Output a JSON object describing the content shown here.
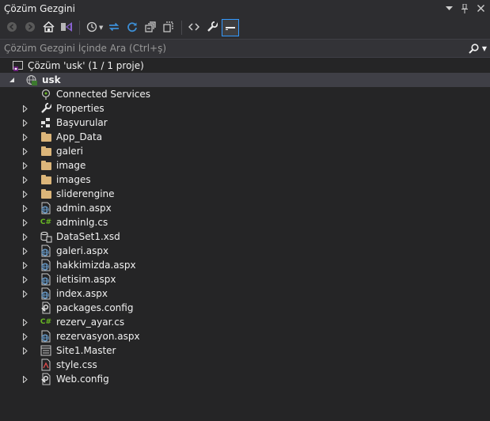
{
  "panel": {
    "title": "Çözüm Gezgini",
    "titlebar_icons": [
      "dropdown-arrow-icon",
      "pin-icon",
      "close-icon"
    ]
  },
  "toolbar": {
    "buttons": [
      {
        "name": "back",
        "icon": "arrow-left-icon",
        "state": "disabled"
      },
      {
        "name": "forward",
        "icon": "arrow-right-icon",
        "state": "disabled"
      },
      {
        "name": "home",
        "icon": "home-icon",
        "state": "enabled"
      },
      {
        "name": "switch-views",
        "icon": "visual-studio-icon",
        "state": "enabled"
      },
      {
        "name": "pending-changes-filter",
        "icon": "clock-icon",
        "state": "enabled"
      },
      {
        "name": "sync-with-active-document",
        "icon": "sync-icon",
        "state": "enabled"
      },
      {
        "name": "refresh",
        "icon": "refresh-icon",
        "state": "enabled"
      },
      {
        "name": "collapse-all",
        "icon": "collapse-all-icon",
        "state": "enabled"
      },
      {
        "name": "show-all-files",
        "icon": "show-all-files-icon",
        "state": "enabled"
      },
      {
        "name": "view-code",
        "icon": "code-icon",
        "state": "enabled"
      },
      {
        "name": "properties",
        "icon": "wrench-icon",
        "state": "enabled"
      },
      {
        "name": "preview-selected-items",
        "icon": "preview-icon",
        "state": "active"
      }
    ]
  },
  "search": {
    "placeholder": "Çözüm Gezgini İçinde Ara (Ctrl+ş)",
    "icon": "search-icon"
  },
  "tree": {
    "solution": {
      "label": "Çözüm 'usk' (1 / 1 proje)",
      "icon": "solution-icon"
    },
    "project": {
      "label": "usk",
      "icon": "web-project-icon",
      "expanded": true
    },
    "items": [
      {
        "label": "Connected Services",
        "icon": "connected-services-icon",
        "expandable": false
      },
      {
        "label": "Properties",
        "icon": "wrench-icon",
        "expandable": true
      },
      {
        "label": "Başvurular",
        "icon": "references-icon",
        "expandable": true
      },
      {
        "label": "App_Data",
        "icon": "folder-icon",
        "expandable": true
      },
      {
        "label": "galeri",
        "icon": "folder-icon",
        "expandable": true
      },
      {
        "label": "image",
        "icon": "folder-icon",
        "expandable": true
      },
      {
        "label": "images",
        "icon": "folder-icon",
        "expandable": true
      },
      {
        "label": "sliderengine",
        "icon": "folder-icon",
        "expandable": true
      },
      {
        "label": "admin.aspx",
        "icon": "aspx-file-icon",
        "expandable": true
      },
      {
        "label": "adminlg.cs",
        "icon": "csharp-file-icon",
        "expandable": true
      },
      {
        "label": "DataSet1.xsd",
        "icon": "dataset-file-icon",
        "expandable": true
      },
      {
        "label": "galeri.aspx",
        "icon": "aspx-file-icon",
        "expandable": true
      },
      {
        "label": "hakkimizda.aspx",
        "icon": "aspx-file-icon",
        "expandable": true
      },
      {
        "label": "iletisim.aspx",
        "icon": "aspx-file-icon",
        "expandable": true
      },
      {
        "label": "index.aspx",
        "icon": "aspx-file-icon",
        "expandable": true
      },
      {
        "label": "packages.config",
        "icon": "config-file-icon",
        "expandable": false
      },
      {
        "label": "rezerv_ayar.cs",
        "icon": "csharp-file-icon",
        "expandable": true
      },
      {
        "label": "rezervasyon.aspx",
        "icon": "aspx-file-icon",
        "expandable": true
      },
      {
        "label": "Site1.Master",
        "icon": "master-page-icon",
        "expandable": true
      },
      {
        "label": "style.css",
        "icon": "css-file-icon",
        "expandable": false
      },
      {
        "label": "Web.config",
        "icon": "config-file-icon",
        "expandable": true
      }
    ]
  }
}
